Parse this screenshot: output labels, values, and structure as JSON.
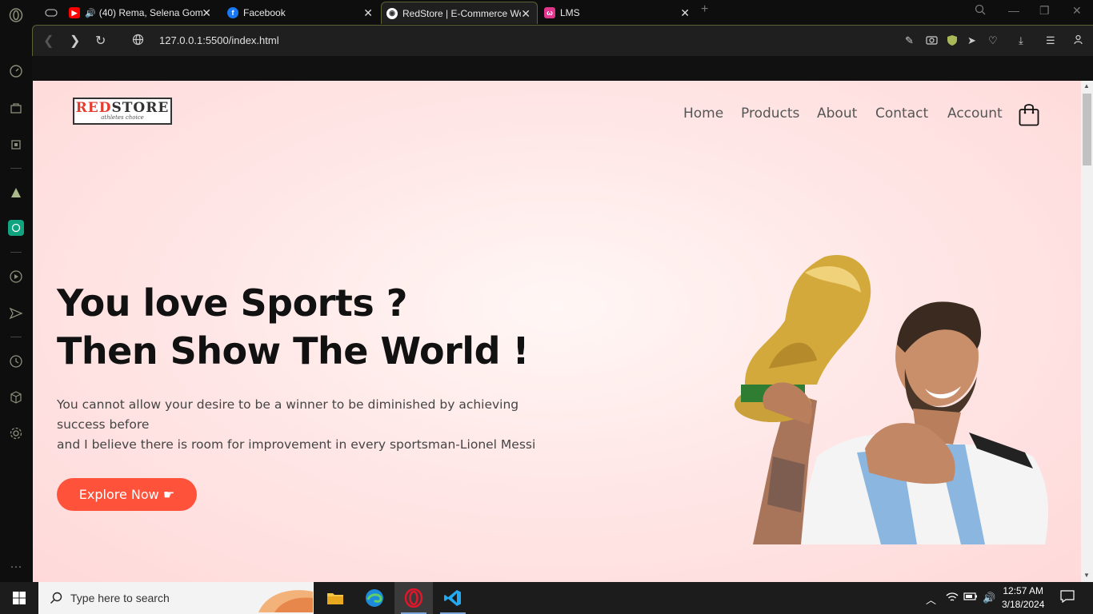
{
  "browser": {
    "tabs": [
      {
        "title": "(40) Rema, Selena Gom",
        "favicon": "youtube-icon"
      },
      {
        "title": "Facebook",
        "favicon": "facebook-icon"
      },
      {
        "title": "RedStore | E-Commerce We",
        "favicon": "globe-icon",
        "active": true
      },
      {
        "title": "LMS",
        "favicon": "lms-icon"
      }
    ],
    "url": "127.0.0.1:5500/index.html"
  },
  "site": {
    "logo": {
      "red": "RED",
      "rest": "STORE",
      "tagline": "athletes choice"
    },
    "nav": [
      "Home",
      "Products",
      "About",
      "Contact",
      "Account"
    ],
    "hero": {
      "title_line1": "You love Sports ?",
      "title_line2": "Then Show The World !",
      "text_line1": "You cannot allow your desire to be a winner to be diminished by achieving",
      "text_line2": "success before",
      "text_line3": "and I believe there is room for improvement in every sportsman-Lionel Messi",
      "button": "Explore Now ☛"
    }
  },
  "taskbar": {
    "search_placeholder": "Type here to search",
    "time": "12:57 AM",
    "date": "3/18/2024"
  },
  "colors": {
    "accent": "#ff523b",
    "logo_red": "#e63b2f",
    "hero_bg": "#ffe0e0"
  }
}
